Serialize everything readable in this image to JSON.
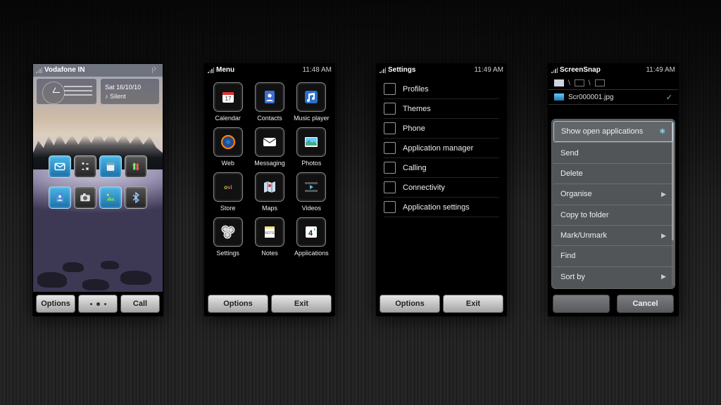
{
  "screen1": {
    "operator": "Vodafone IN",
    "date": "Sat 16/10/10",
    "profile": "Silent",
    "soft_left": "Options",
    "soft_right": "Call"
  },
  "screen2": {
    "title": "Menu",
    "time": "11:48 AM",
    "apps": [
      {
        "label": "Calendar"
      },
      {
        "label": "Contacts"
      },
      {
        "label": "Music player"
      },
      {
        "label": "Web"
      },
      {
        "label": "Messaging"
      },
      {
        "label": "Photos"
      },
      {
        "label": "Store"
      },
      {
        "label": "Maps"
      },
      {
        "label": "Videos"
      },
      {
        "label": "Settings"
      },
      {
        "label": "Notes"
      },
      {
        "label": "Applications"
      }
    ],
    "soft_left": "Options",
    "soft_right": "Exit"
  },
  "screen3": {
    "title": "Settings",
    "time": "11:49 AM",
    "items": [
      "Profiles",
      "Themes",
      "Phone",
      "Application manager",
      "Calling",
      "Connectivity",
      "Application settings"
    ],
    "soft_left": "Options",
    "soft_right": "Exit"
  },
  "screen4": {
    "title": "ScreenSnap",
    "time": "11:49 AM",
    "filename": "Scr000001.jpg",
    "menu": [
      {
        "label": "Show open applications",
        "burst": true
      },
      {
        "label": "Send"
      },
      {
        "label": "Delete"
      },
      {
        "label": "Organise",
        "sub": true
      },
      {
        "label": "Copy to folder"
      },
      {
        "label": "Mark/Unmark",
        "sub": true
      },
      {
        "label": "Find"
      },
      {
        "label": "Sort by",
        "sub": true
      }
    ],
    "soft_right": "Cancel"
  }
}
